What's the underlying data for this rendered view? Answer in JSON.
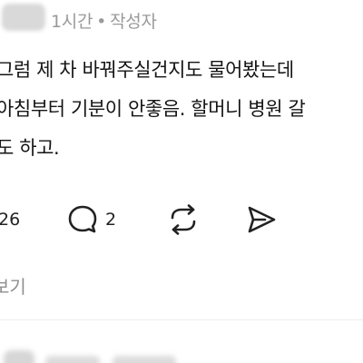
{
  "comment": {
    "time": "1시간",
    "separator": "•",
    "author_badge": "작성자",
    "lines": [
      "그럼 제 차 바꿔주실건지도 물어봤는데",
      "아침부터 기분이 안좋음. 할머니 병원 갈",
      "도 하고."
    ]
  },
  "actions": {
    "like_count": "26",
    "comment_count": "2"
  },
  "view_more_label": "보기",
  "icons": {
    "like": "heart-icon",
    "comment": "speech-bubble-icon",
    "repost": "repost-icon",
    "share": "send-icon"
  }
}
